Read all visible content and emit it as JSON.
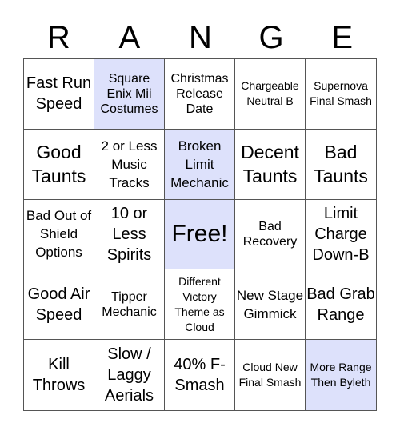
{
  "title_letters": [
    "R",
    "A",
    "N",
    "G",
    "E"
  ],
  "marked_color": "#dde1fb",
  "cells": [
    {
      "text": "Fast Run Speed",
      "marked": false,
      "size": "l"
    },
    {
      "text": "Square Enix Mii Costumes",
      "marked": true,
      "size": "s"
    },
    {
      "text": "Christmas Release Date",
      "marked": false,
      "size": "s"
    },
    {
      "text": "Chargeable Neutral B",
      "marked": false,
      "size": "xs"
    },
    {
      "text": "Supernova Final Smash",
      "marked": false,
      "size": "xs"
    },
    {
      "text": "Good Taunts",
      "marked": false,
      "size": "xl-m"
    },
    {
      "text": "2 or Less Music Tracks",
      "marked": false,
      "size": "m-s"
    },
    {
      "text": "Broken Limit Mechanic",
      "marked": true,
      "size": "m-s"
    },
    {
      "text": "Decent Taunts",
      "marked": false,
      "size": "xl-m"
    },
    {
      "text": "Bad Taunts",
      "marked": false,
      "size": "xl-m"
    },
    {
      "text": "Bad Out of Shield Options",
      "marked": false,
      "size": "m-s"
    },
    {
      "text": "10 or Less Spirits",
      "marked": false,
      "size": "l"
    },
    {
      "text": "Free!",
      "marked": true,
      "size": "xl"
    },
    {
      "text": "Bad Recovery",
      "marked": false,
      "size": "s"
    },
    {
      "text": "Limit Charge Down-B",
      "marked": false,
      "size": "l"
    },
    {
      "text": "Good Air Speed",
      "marked": false,
      "size": "l"
    },
    {
      "text": "Tipper Mechanic",
      "marked": false,
      "size": "s"
    },
    {
      "text": "Different Victory Theme as Cloud",
      "marked": false,
      "size": "xs"
    },
    {
      "text": "New Stage Gimmick",
      "marked": false,
      "size": "m-s"
    },
    {
      "text": "Bad Grab Range",
      "marked": false,
      "size": "l"
    },
    {
      "text": "Kill Throws",
      "marked": false,
      "size": "l"
    },
    {
      "text": "Slow / Laggy Aerials",
      "marked": false,
      "size": "l"
    },
    {
      "text": "40% F-Smash",
      "marked": false,
      "size": "l"
    },
    {
      "text": "Cloud New Final Smash",
      "marked": false,
      "size": "xs"
    },
    {
      "text": "More Range Then Byleth",
      "marked": true,
      "size": "xs"
    }
  ]
}
